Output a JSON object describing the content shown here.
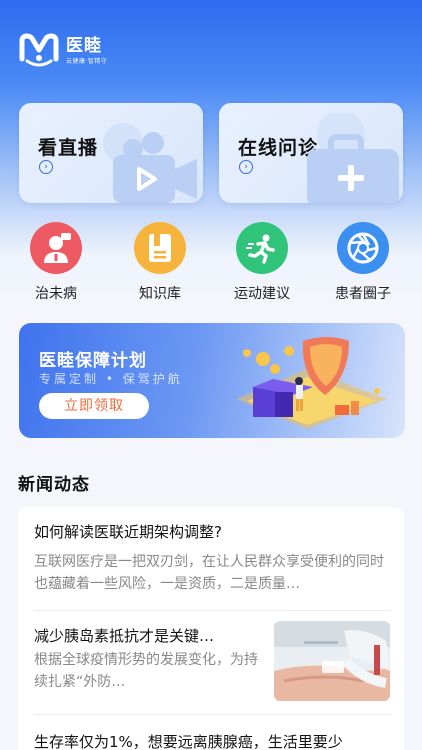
{
  "app": {
    "name": "医睦",
    "slogan": "云健康·智精守"
  },
  "cards": {
    "live": {
      "title": "看直播",
      "icon": "video-camera-icon"
    },
    "consult": {
      "title": "在线问诊",
      "icon": "medical-kit-icon"
    }
  },
  "quick": [
    {
      "label": "治未病",
      "icon": "doctor-icon",
      "color": "#ee5a63"
    },
    {
      "label": "知识库",
      "icon": "book-icon",
      "color": "#f6b43c"
    },
    {
      "label": "运动建议",
      "icon": "running-icon",
      "color": "#2fc47a"
    },
    {
      "label": "患者圈子",
      "icon": "aperture-icon",
      "color": "#3b8ff0"
    }
  ],
  "banner": {
    "title": "医睦保障计划",
    "subtitle": "专属定制 • 保驾护航",
    "button": "立即领取"
  },
  "news": {
    "section_title": "新闻动态",
    "items": [
      {
        "title": "如何解读医联近期架构调整?",
        "summary": "互联网医疗是一把双刃剑，在让人民群众享受便利的同时也蕴藏着一些风险，一是资质，二是质量…"
      },
      {
        "title": "减少胰岛素抵抗才是关键…",
        "summary": "根据全球疫情形势的发展变化，为持续扎紧“外防…",
        "thumb": "blood-test-photo"
      },
      {
        "title": "生存率仅为1%，想要远离胰腺癌，生活里要少"
      }
    ]
  },
  "colors": {
    "primary": "#2e6cf0",
    "button_text": "#f06b3b"
  }
}
